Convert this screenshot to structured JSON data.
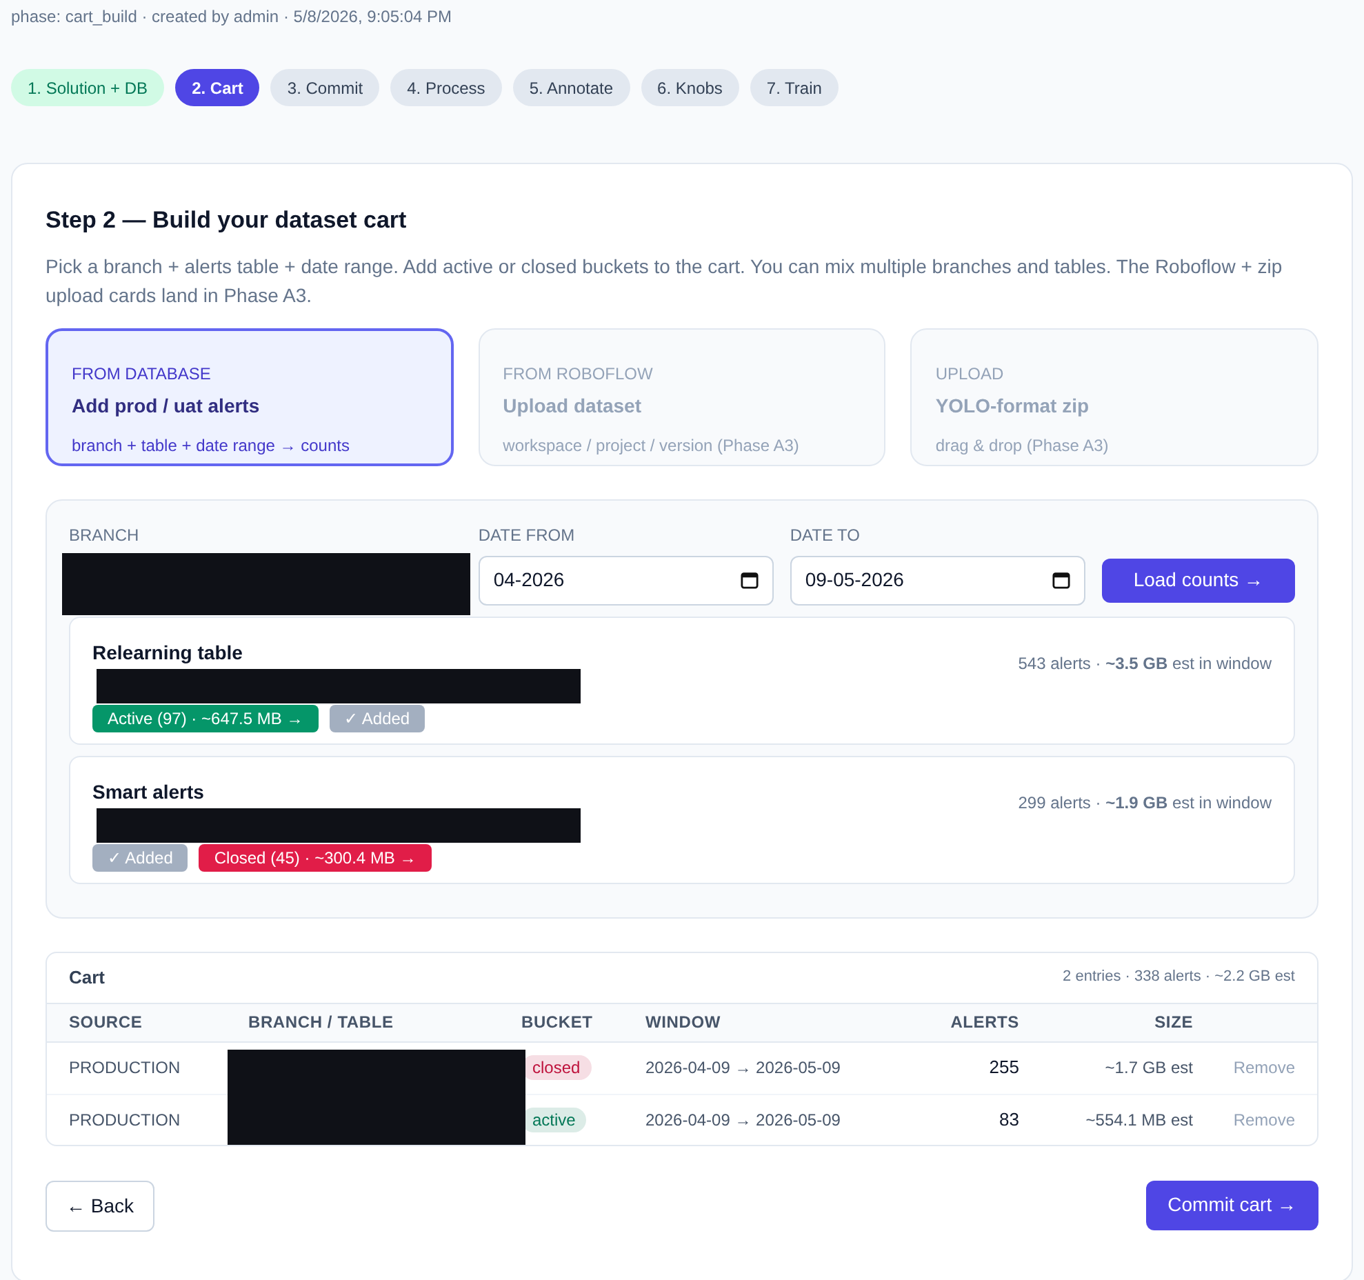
{
  "meta": "phase: cart_build · created by admin · 5/8/2026, 9:05:04 PM",
  "steps": [
    {
      "label": "1. Solution + DB",
      "selected": false,
      "completed": true
    },
    {
      "label": "2. Cart",
      "selected": true,
      "completed": false
    },
    {
      "label": "3. Commit",
      "selected": false,
      "completed": false
    },
    {
      "label": "4. Process",
      "selected": false,
      "completed": false
    },
    {
      "label": "5. Annotate",
      "selected": false,
      "completed": false
    },
    {
      "label": "6. Knobs",
      "selected": false,
      "completed": false
    },
    {
      "label": "7. Train",
      "selected": false,
      "completed": false
    }
  ],
  "title": "Step 2 — Build your dataset cart",
  "description": "Pick a branch + alerts table + date range. Add active or closed buckets to the cart. You can mix multiple branches and tables. The Roboflow + zip upload cards land in Phase A3.",
  "sources": [
    {
      "eyebrow": "FROM DATABASE",
      "title": "Add prod / uat alerts",
      "hint": "branch + table + date range → counts",
      "selected": true
    },
    {
      "eyebrow": "FROM ROBOFLOW",
      "title": "Upload dataset",
      "hint": "workspace / project / version (Phase A3)",
      "selected": false
    },
    {
      "eyebrow": "UPLOAD",
      "title": "YOLO-format zip",
      "hint": "drag & drop (Phase A3)",
      "selected": false
    }
  ],
  "filters": {
    "branch_label": "BRANCH",
    "date_from_label": "DATE FROM",
    "date_from": "04-2026",
    "date_to_label": "DATE TO",
    "date_to": "09-05-2026",
    "load_button": "Load counts →"
  },
  "tables": [
    {
      "name": "Relearning table",
      "summary": "543 alerts · **~3.5 GB** est in window",
      "buckets": [
        {
          "label": "Active (97) · ~647.5 MB →",
          "kind": "active"
        },
        {
          "label": "✓ Added",
          "kind": "added"
        }
      ]
    },
    {
      "name": "Smart alerts",
      "summary": "299 alerts · **~1.9 GB** est in window",
      "buckets": [
        {
          "label": "✓ Added",
          "kind": "added"
        },
        {
          "label": "Closed (45) · ~300.4 MB →",
          "kind": "closed"
        }
      ]
    }
  ],
  "cart": {
    "title": "Cart",
    "summary": "2 entries · 338 alerts · ~2.2 GB est",
    "columns": [
      "SOURCE",
      "BRANCH / TABLE",
      "BUCKET",
      "WINDOW",
      "ALERTS",
      "SIZE"
    ],
    "rows": [
      {
        "source": "PRODUCTION",
        "bucket": "closed",
        "color": "#be123c",
        "window": "2026-04-09 → 2026-05-09",
        "alerts": "255",
        "size": "~1.7 GB est",
        "action": "Remove"
      },
      {
        "source": "PRODUCTION",
        "bucket": "active",
        "color": "#047857",
        "window": "2026-04-09 → 2026-05-09",
        "alerts": "83",
        "size": "~554.1 MB est",
        "action": "Remove"
      }
    ]
  },
  "back_button": "← Back",
  "commit_button": "Commit cart →"
}
